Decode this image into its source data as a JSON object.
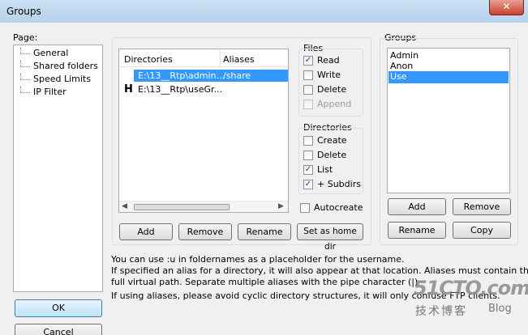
{
  "window": {
    "title": "Groups",
    "close_glyph": "✕"
  },
  "page_section": {
    "label": "Page:",
    "items": [
      "General",
      "Shared folders",
      "Speed Limits",
      "IP Filter"
    ]
  },
  "folders": {
    "columns": [
      "Directories",
      "Aliases"
    ],
    "rows": [
      {
        "marker": "",
        "directory": "E:\\13__Rtp\\admin...",
        "alias": "/share"
      },
      {
        "marker": "H",
        "directory": "E:\\13__Rtp\\useGr...",
        "alias": ""
      }
    ],
    "buttons": {
      "add": "Add",
      "remove": "Remove",
      "rename": "Rename",
      "home": "Set as home dir"
    }
  },
  "files_perms": {
    "label": "Files",
    "items": [
      {
        "label": "Read",
        "checked": true,
        "disabled": false
      },
      {
        "label": "Write",
        "checked": false,
        "disabled": false
      },
      {
        "label": "Delete",
        "checked": false,
        "disabled": false
      },
      {
        "label": "Append",
        "checked": false,
        "disabled": true
      }
    ]
  },
  "dir_perms": {
    "label": "Directories",
    "items": [
      {
        "label": "Create",
        "checked": false
      },
      {
        "label": "Delete",
        "checked": false
      },
      {
        "label": "List",
        "checked": true
      },
      {
        "label": "+ Subdirs",
        "checked": true
      }
    ]
  },
  "autocreate": {
    "label": "Autocreate",
    "checked": false
  },
  "groups": {
    "label": "Groups",
    "items": [
      "Admin",
      "Anon",
      "Use"
    ],
    "selected": 2,
    "buttons": {
      "add": "Add",
      "remove": "Remove",
      "rename": "Rename",
      "copy": "Copy"
    }
  },
  "info_text": {
    "line1": "You can use :u in foldernames as a placeholder for the username.",
    "line2": "If specified an alias for a directory, it will also appear at that location. Aliases must contain the",
    "line3": "full virtual path. Separate multiple aliases with the pipe character (|)",
    "line4": "If using aliases, please avoid cyclic directory structures, it will only confuse FTP clients."
  },
  "dialog_buttons": {
    "ok": "OK",
    "cancel": "Cancel"
  },
  "check_glyph": "✓",
  "watermark": {
    "site": "51CTO.com",
    "sub": "技术博客",
    "blog": "Blog"
  }
}
